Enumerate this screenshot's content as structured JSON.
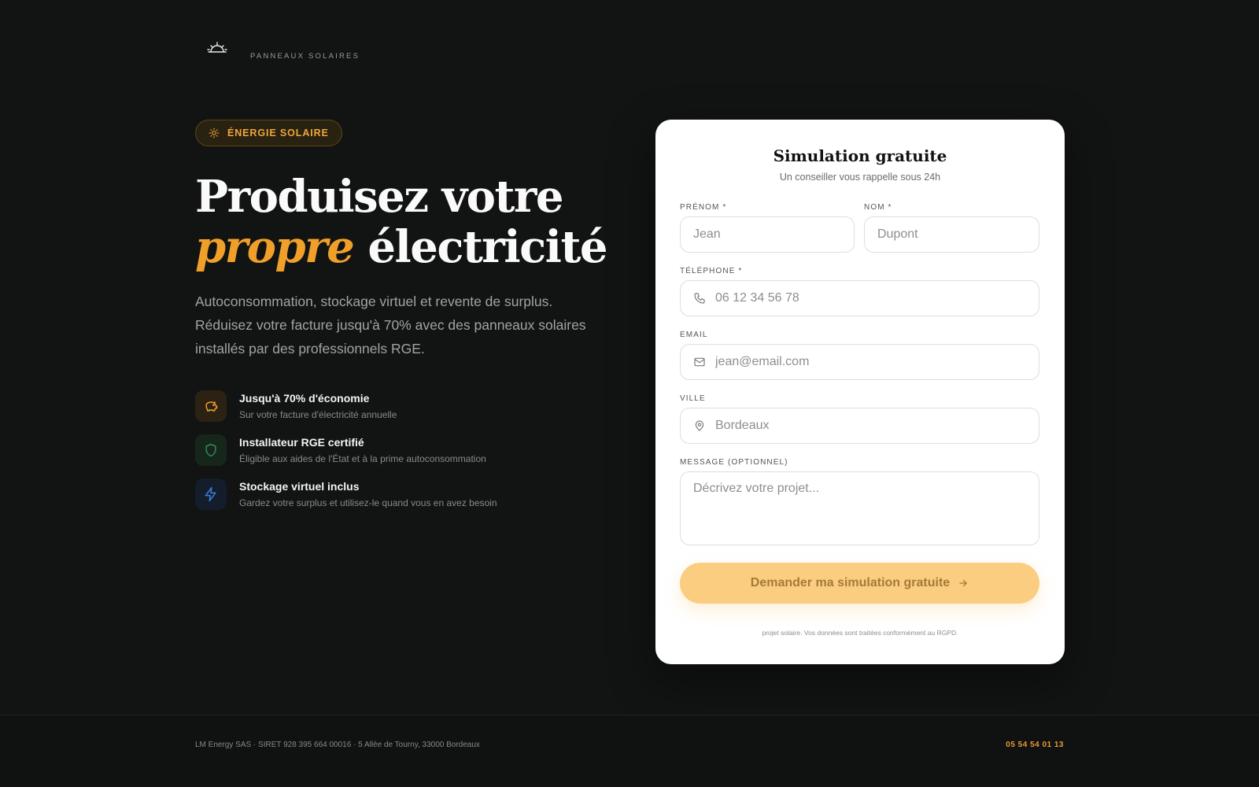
{
  "header": {
    "brand": "PANNEAUX SOLAIRES",
    "logo_icon": "sunrise-icon"
  },
  "hero": {
    "badge": "ÉNERGIE SOLAIRE",
    "badge_icon": "sun-icon",
    "title_line1": "Produisez votre",
    "title_accent": "propre",
    "title_rest": "électricité",
    "lead": "Autoconsommation, stockage virtuel et revente de surplus. Réduisez votre facture jusqu'à 70% avec des panneaux solaires installés par des professionnels RGE."
  },
  "features": [
    {
      "icon": "piggy-bank-icon",
      "title": "Jusqu'à 70% d'économie",
      "desc": "Sur votre facture d'électricité annuelle",
      "color": "#f0a02a"
    },
    {
      "icon": "shield-icon",
      "title": "Installateur RGE certifié",
      "desc": "Éligible aux aides de l'État et à la prime autoconsommation",
      "color": "#2f8a4e"
    },
    {
      "icon": "lightning-icon",
      "title": "Stockage virtuel inclus",
      "desc": "Gardez votre surplus et utilisez-le quand vous en avez besoin",
      "color": "#3b7de0"
    }
  ],
  "form": {
    "title": "Simulation gratuite",
    "subtitle": "Un conseiller vous rappelle sous 24h",
    "fields": {
      "firstname": {
        "label": "PRÉNOM *",
        "placeholder": "Jean",
        "value": ""
      },
      "lastname": {
        "label": "NOM *",
        "placeholder": "Dupont",
        "value": ""
      },
      "phone": {
        "label": "TÉLÉPHONE *",
        "placeholder": "06 12 34 56 78",
        "value": "",
        "icon": "phone-icon"
      },
      "email": {
        "label": "EMAIL",
        "placeholder": "jean@email.com",
        "value": "",
        "icon": "mail-icon"
      },
      "city": {
        "label": "VILLE",
        "placeholder": "Bordeaux",
        "value": "",
        "icon": "map-pin-icon"
      },
      "message": {
        "label": "MESSAGE (OPTIONNEL)",
        "placeholder": "Décrivez votre projet...",
        "value": ""
      }
    },
    "submit_label": "Demander ma simulation gratuite",
    "legal": "projet solaire. Vos données sont traitées conformément au RGPD."
  },
  "footer": {
    "company": "LM Energy SAS · SIRET 928 395 664 00016 · 5 Allée de Tourny, 33000 Bordeaux",
    "phone": "05 54 54 01 13"
  },
  "colors": {
    "accent": "#f0a02a",
    "background": "#121313",
    "button": "#fbcd80"
  }
}
